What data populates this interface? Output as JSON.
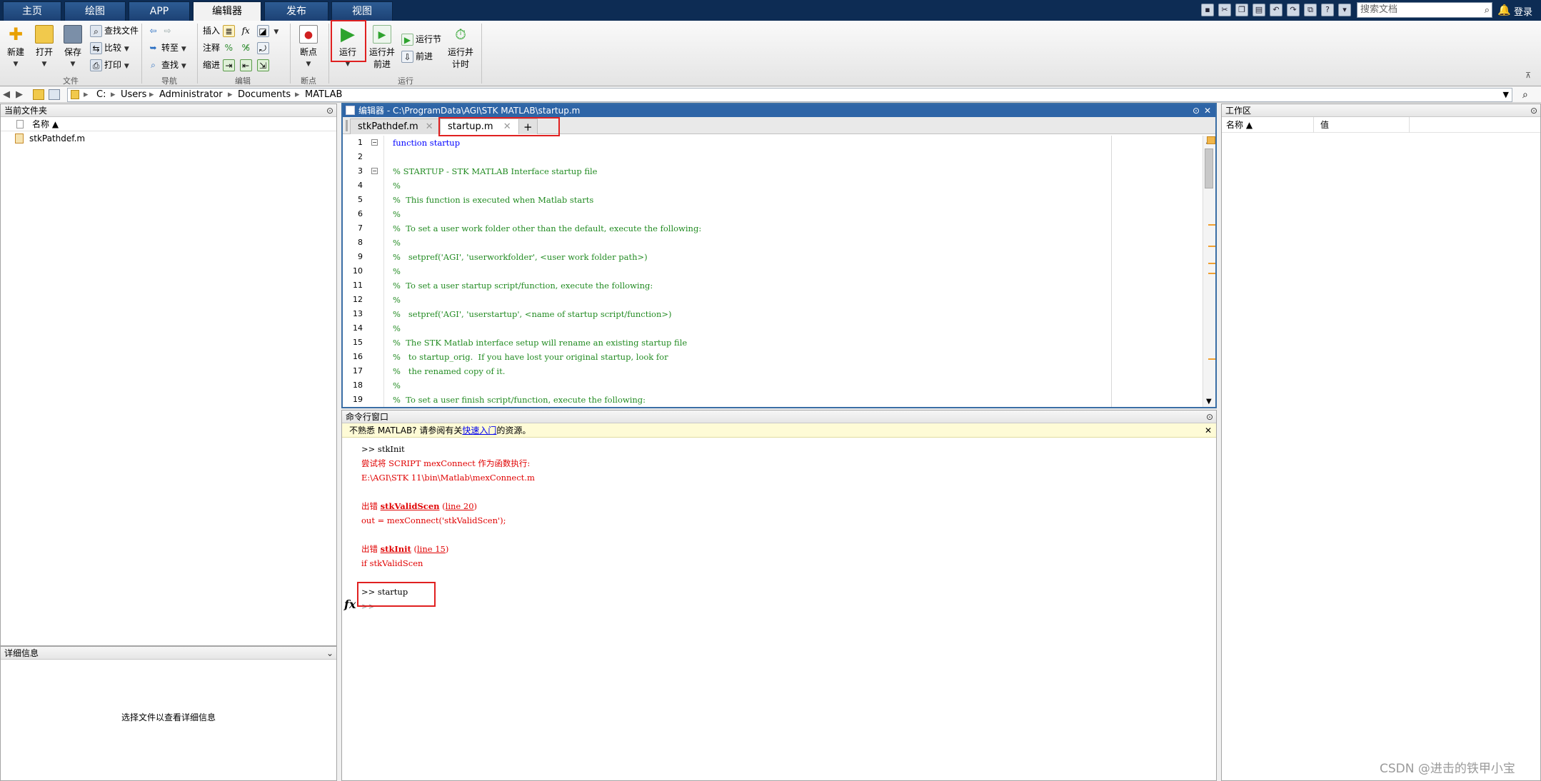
{
  "toptabs": [
    "主页",
    "绘图",
    "APP",
    "编辑器",
    "发布",
    "视图"
  ],
  "search_doc_placeholder": "搜索文档",
  "login": "登录",
  "ribbon": {
    "file": {
      "new": "新建",
      "open": "打开",
      "save": "保存",
      "find_files": "查找文件",
      "compare": "比较",
      "print": "打印",
      "group": "文件"
    },
    "nav": {
      "goto": "转至",
      "find": "查找",
      "group": "导航"
    },
    "edit": {
      "insert": "插入",
      "comment": "注释",
      "indent": "缩进",
      "group": "编辑"
    },
    "breakpoints": {
      "label": "断点",
      "group": "断点"
    },
    "run": {
      "run": "运行",
      "run_advance_1": "运行并",
      "run_advance_2": "前进",
      "run_section": "运行节",
      "advance": "前进",
      "run_time_1": "运行并",
      "run_time_2": "计时",
      "group": "运行"
    }
  },
  "address": {
    "segments": [
      "C:",
      "Users",
      "Administrator",
      "Documents",
      "MATLAB"
    ]
  },
  "current_folder": {
    "title": "当前文件夹",
    "col_name": "名称 ▲",
    "files": [
      "stkPathdef.m"
    ]
  },
  "details": {
    "title": "详细信息",
    "placeholder": "选择文件以查看详细信息"
  },
  "editor": {
    "title": "编辑器 - C:\\ProgramData\\AGI\\STK MATLAB\\startup.m",
    "tabs": [
      "stkPathdef.m",
      "startup.m"
    ],
    "lines": [
      {
        "n": "1",
        "text": "function startup"
      },
      {
        "n": "2",
        "text": ""
      },
      {
        "n": "3",
        "text": "% STARTUP - STK MATLAB Interface startup file"
      },
      {
        "n": "4",
        "text": "%"
      },
      {
        "n": "5",
        "text": "%  This function is executed when Matlab starts"
      },
      {
        "n": "6",
        "text": "%"
      },
      {
        "n": "7",
        "text": "%  To set a user work folder other than the default, execute the following:"
      },
      {
        "n": "8",
        "text": "%"
      },
      {
        "n": "9",
        "text": "%   setpref('AGI', 'userworkfolder', <user work folder path>)"
      },
      {
        "n": "10",
        "text": "%"
      },
      {
        "n": "11",
        "text": "%  To set a user startup script/function, execute the following:"
      },
      {
        "n": "12",
        "text": "%"
      },
      {
        "n": "13",
        "text": "%   setpref('AGI', 'userstartup', <name of startup script/function>)"
      },
      {
        "n": "14",
        "text": "%"
      },
      {
        "n": "15",
        "text": "%  The STK Matlab interface setup will rename an existing startup file"
      },
      {
        "n": "16",
        "text": "%   to startup_orig.  If you have lost your original startup, look for"
      },
      {
        "n": "17",
        "text": "%   the renamed copy of it."
      },
      {
        "n": "18",
        "text": "%"
      },
      {
        "n": "19",
        "text": "%  To set a user finish script/function, execute the following:"
      }
    ]
  },
  "command_window": {
    "title": "命令行窗口",
    "info_prefix": "不熟悉 MATLAB? 请参阅有关",
    "info_link": "快速入门",
    "info_suffix": "的资源。",
    "l1": ">> stkInit",
    "l2": "尝试将 SCRIPT mexConnect 作为函数执行:",
    "l3": "E:\\AGI\\STK 11\\bin\\Matlab\\mexConnect.m",
    "e1_prefix": "出错 ",
    "e1_func": "stkValidScen",
    "e1_ref": "line 20",
    "l5": "out = mexConnect('stkValidScen');",
    "e2_prefix": "出错 ",
    "e2_func": "stkInit",
    "e2_ref": "line 15",
    "l7": "if stkValidScen",
    "l8": ">> startup",
    "prompt": ">>",
    "fx": "fx"
  },
  "workspace": {
    "title": "工作区",
    "col_name": "名称 ▲",
    "col_value": "值"
  },
  "watermark": "CSDN @进击的铁甲小宝"
}
